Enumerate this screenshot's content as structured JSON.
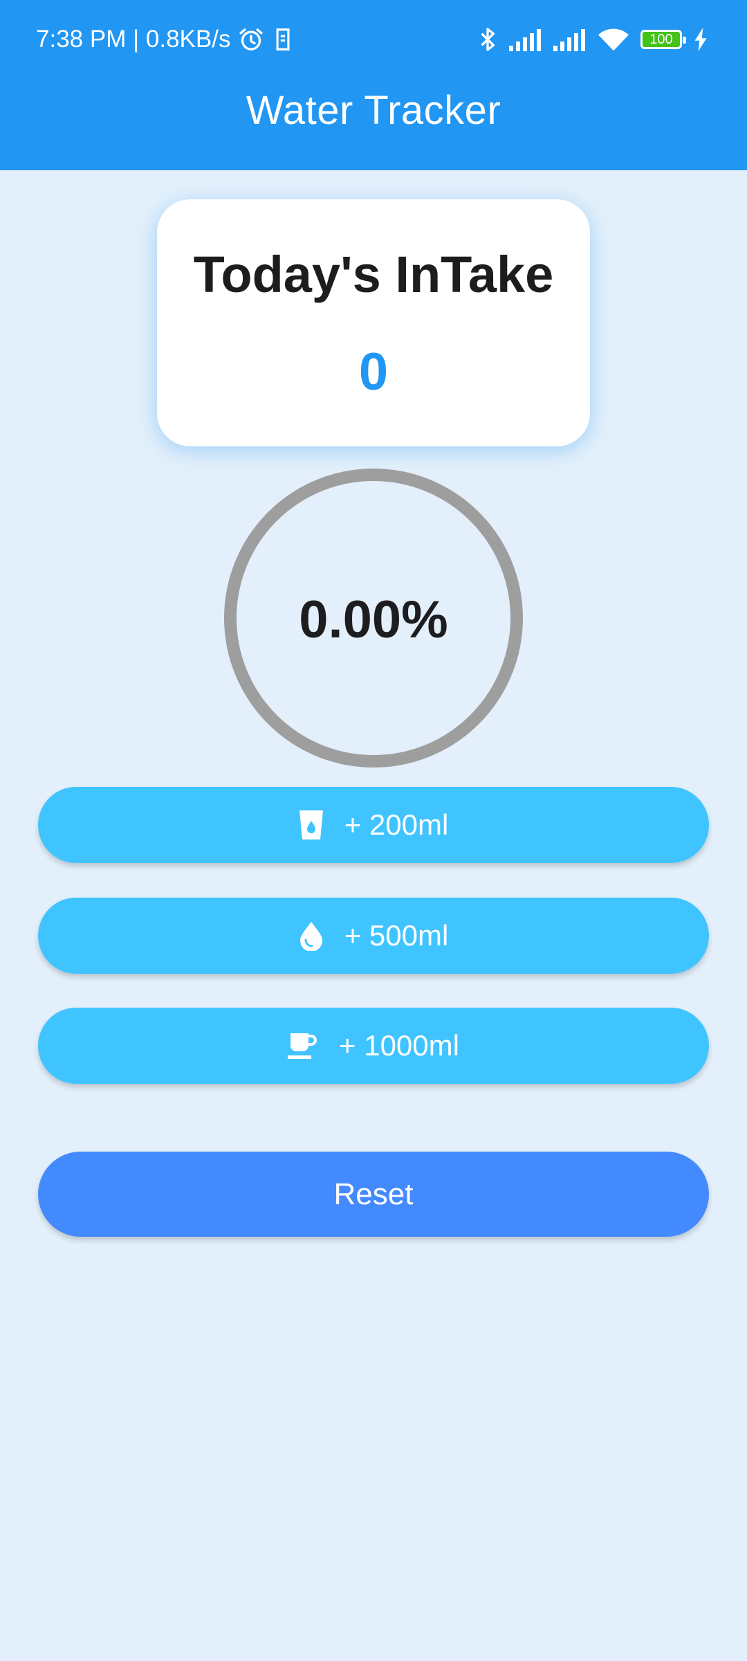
{
  "status_bar": {
    "time_speed": "7:38 PM | 0.8KB/s",
    "battery_level": "100",
    "icons": [
      "alarm-icon",
      "sim-icon",
      "bluetooth-icon",
      "signal-icon",
      "signal-icon",
      "wifi-icon",
      "battery-icon",
      "charging-icon"
    ]
  },
  "app_bar": {
    "title": "Water Tracker"
  },
  "intake": {
    "title": "Today's InTake",
    "value": "0"
  },
  "progress": {
    "label": "0.00%",
    "fraction": 0.0,
    "track_color": "#9E9E9E"
  },
  "buttons": {
    "add_200": {
      "label": "+ 200ml",
      "icon": "glass-water-icon"
    },
    "add_500": {
      "label": "+ 500ml",
      "icon": "water-drop-icon"
    },
    "add_1000": {
      "label": "+ 1000ml",
      "icon": "mug-icon"
    },
    "reset": {
      "label": "Reset"
    }
  },
  "colors": {
    "primary": "#2196F3",
    "background": "#E3F0FB",
    "add_button": "#40C4FF",
    "reset_button": "#448AFF"
  }
}
